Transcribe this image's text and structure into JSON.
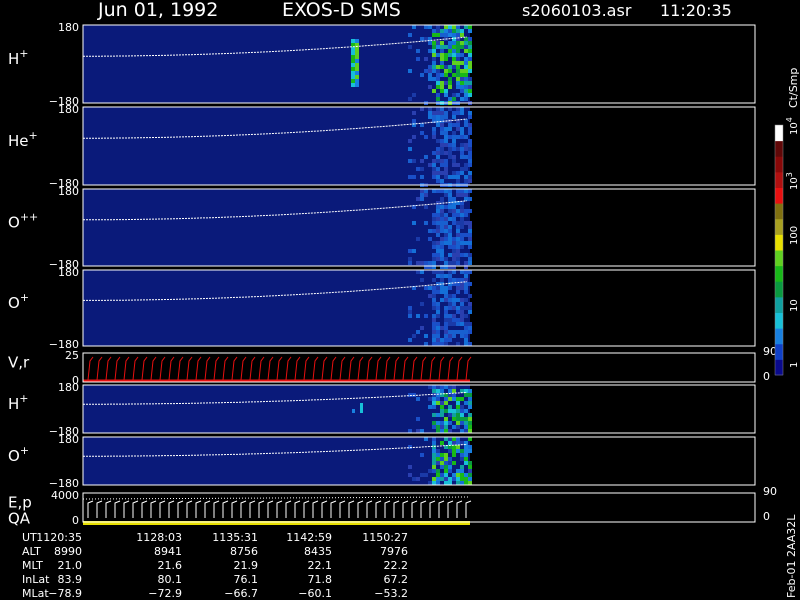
{
  "header": {
    "date": "Jun 01, 1992",
    "instrument": "EXOS-D SMS",
    "file": "s2060103.asr",
    "time": "11:20:35"
  },
  "colorbar": {
    "unit_label": "Ct/Smp",
    "tick_labels": [
      "1",
      "10",
      "100",
      "10",
      "10"
    ],
    "tick_exponents": [
      "",
      "",
      "",
      "3",
      "4"
    ],
    "colors": [
      "#0a0a8c",
      "#0f40c8",
      "#1880e0",
      "#18c0d8",
      "#10a0a0",
      "#0a9a40",
      "#18b818",
      "#60d020",
      "#e8e000",
      "#a8a020",
      "#807010",
      "#e81010",
      "#b01010",
      "#880808",
      "#600808",
      "#ffffff"
    ]
  },
  "footer": {
    "stamp": "Feb-01 2AA32L"
  },
  "chart_data": {
    "type": "heatmap",
    "panels": [
      {
        "label": "H",
        "superscript": "+",
        "y_top": "180",
        "y_bottom": "−180"
      },
      {
        "label": "He",
        "superscript": "+",
        "y_top": "180",
        "y_bottom": "−180"
      },
      {
        "label": "O",
        "superscript": "++",
        "y_top": "180",
        "y_bottom": "−180"
      },
      {
        "label": "O",
        "superscript": "+",
        "y_top": "180",
        "y_bottom": "−180"
      },
      {
        "label": "V,r",
        "superscript": "",
        "y_top": "25",
        "y_bottom": "0",
        "right_top": "90",
        "right_bottom": "0"
      },
      {
        "label": "H",
        "superscript": "+",
        "y_top": "180",
        "y_bottom": "−180"
      },
      {
        "label": "O",
        "superscript": "+",
        "y_top": "180",
        "y_bottom": "−180"
      },
      {
        "label": "E,p",
        "label2": "QA",
        "superscript": "",
        "y_top": "4000",
        "y_bottom": "0",
        "right_top": "90",
        "right_bottom": "0"
      }
    ],
    "time_axis": {
      "row_labels": [
        "UT",
        "ALT",
        "MLT",
        "InLat",
        "MLat"
      ],
      "columns": [
        [
          "1120:35",
          "8990",
          "21.0",
          "83.9",
          "−78.9"
        ],
        [
          "1128:03",
          "8941",
          "21.6",
          "80.1",
          "−72.9"
        ],
        [
          "1135:31",
          "8756",
          "21.9",
          "76.1",
          "−66.7"
        ],
        [
          "1142:59",
          "8435",
          "22.1",
          "71.8",
          "−60.1"
        ],
        [
          "1150:27",
          "7976",
          "22.2",
          "67.2",
          "−53.2"
        ]
      ]
    },
    "colorbar_range": [
      1,
      10000
    ],
    "colorbar_scale": "log"
  }
}
